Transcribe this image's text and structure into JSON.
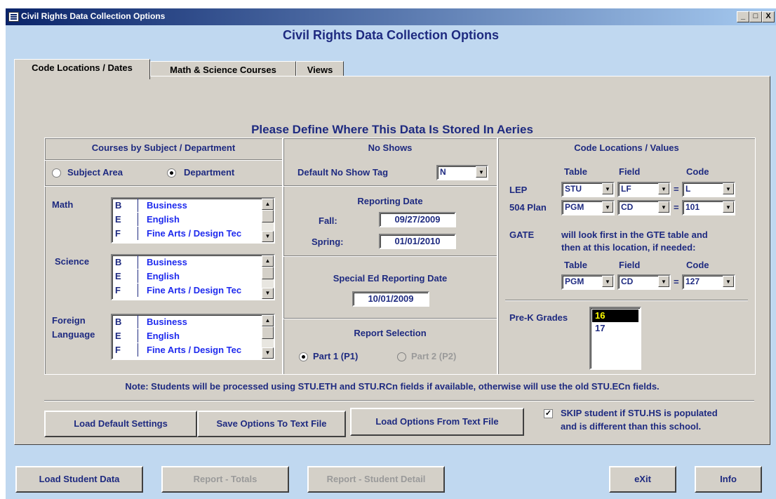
{
  "window": {
    "title": "Civil Rights Data Collection Options",
    "controls": [
      "_",
      "□",
      "X"
    ]
  },
  "form_title": "Civil Rights Data Collection Options",
  "tabs": [
    {
      "label": "Code Locations / Dates",
      "active": true
    },
    {
      "label": "Math & Science Courses",
      "active": false
    },
    {
      "label": "Views",
      "active": false
    }
  ],
  "heading": "Please Define Where This Data Is Stored In Aeries",
  "courses": {
    "title": "Courses by Subject / Department",
    "radio_subject": "Subject Area",
    "radio_department": "Department",
    "groups": [
      {
        "label": "Math",
        "items": [
          {
            "code": "B",
            "desc": "Business"
          },
          {
            "code": "E",
            "desc": "English"
          },
          {
            "code": "F",
            "desc": "Fine Arts / Design Tec"
          }
        ]
      },
      {
        "label": "Science",
        "items": [
          {
            "code": "B",
            "desc": "Business"
          },
          {
            "code": "E",
            "desc": "English"
          },
          {
            "code": "F",
            "desc": "Fine Arts / Design Tec"
          }
        ]
      },
      {
        "label": "Foreign\nLanguage",
        "label1": "Foreign",
        "label2": "Language",
        "items": [
          {
            "code": "B",
            "desc": "Business"
          },
          {
            "code": "E",
            "desc": "English"
          },
          {
            "code": "F",
            "desc": "Fine Arts / Design Tec"
          }
        ]
      }
    ]
  },
  "no_shows": {
    "title": "No Shows",
    "label": "Default No Show Tag",
    "value": "N"
  },
  "reporting_date": {
    "title": "Reporting Date",
    "fall_label": "Fall:",
    "fall_value": "09/27/2009",
    "spring_label": "Spring:",
    "spring_value": "01/01/2010"
  },
  "sped": {
    "title": "Special Ed Reporting Date",
    "value": "10/01/2009"
  },
  "report_selection": {
    "title": "Report Selection",
    "part1": "Part 1  (P1)",
    "part2": "Part 2  (P2)"
  },
  "code_locations": {
    "title": "Code Locations / Values",
    "col_table": "Table",
    "col_field": "Field",
    "col_code": "Code",
    "lep": {
      "label": "LEP",
      "table": "STU",
      "field": "LF",
      "eq": "=",
      "code": "L"
    },
    "plan504": {
      "label": "504 Plan",
      "table": "PGM",
      "field": "CD",
      "eq": "=",
      "code": "101"
    },
    "gate_label": "GATE",
    "gate_note1": "will look first in the GTE table and",
    "gate_note2": "then at this location, if needed:",
    "gate": {
      "table": "PGM",
      "field": "CD",
      "eq": "=",
      "code": "127"
    },
    "prek_label": "Pre-K Grades",
    "prek_items": [
      "16",
      "17"
    ]
  },
  "note": "Note: Students will be processed using STU.ETH and STU.RCn fields if available, otherwise will use the old STU.ECn fields.",
  "buttons": {
    "load_default": "Load Default Settings",
    "save_options": "Save Options To Text File",
    "load_options": "Load Options From Text File",
    "skip_line1": "SKIP student if STU.HS is populated",
    "skip_line2": "and is different than this school.",
    "skip_checked": "✓"
  },
  "bottom": {
    "load_student_data": "Load Student Data",
    "report_totals": "Report - Totals",
    "report_detail": "Report - Student Detail",
    "exit": "eXit",
    "info": "Info"
  }
}
